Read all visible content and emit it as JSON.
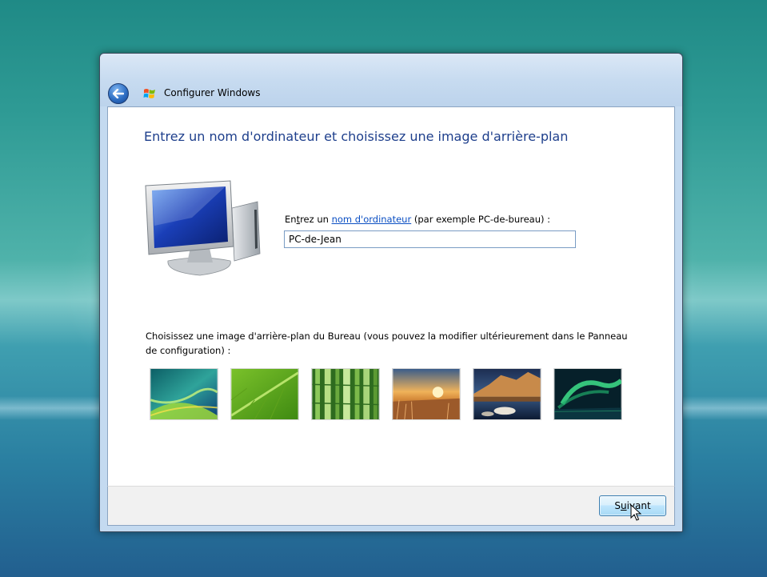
{
  "window": {
    "title": "Configurer Windows"
  },
  "main": {
    "heading": "Entrez un nom d'ordinateur et choisissez une image d'arrière-plan",
    "name_label_pre": "En",
    "name_label_accel": "t",
    "name_label_mid": "rez un ",
    "name_label_link": "nom d'ordinateur",
    "name_label_post": " (par exemple PC-de-bureau) :",
    "computer_name_value": "PC-de-Jean",
    "background_label": "Choisissez une image d'arrière-plan du Bureau (vous pouvez la modifier ultérieurement dans le Panneau de configuration) :",
    "wallpapers": [
      "aurora-green-wallpaper",
      "green-leaf-wallpaper",
      "bamboo-wallpaper",
      "sunset-field-wallpaper",
      "lake-rocks-wallpaper",
      "northern-lights-wallpaper"
    ]
  },
  "footer": {
    "next_pre": "S",
    "next_accel": "u",
    "next_post": "ivant"
  },
  "colors": {
    "heading": "#1e3f8c",
    "link": "#0b4fc3",
    "titlebar": "#c7dbf0"
  }
}
